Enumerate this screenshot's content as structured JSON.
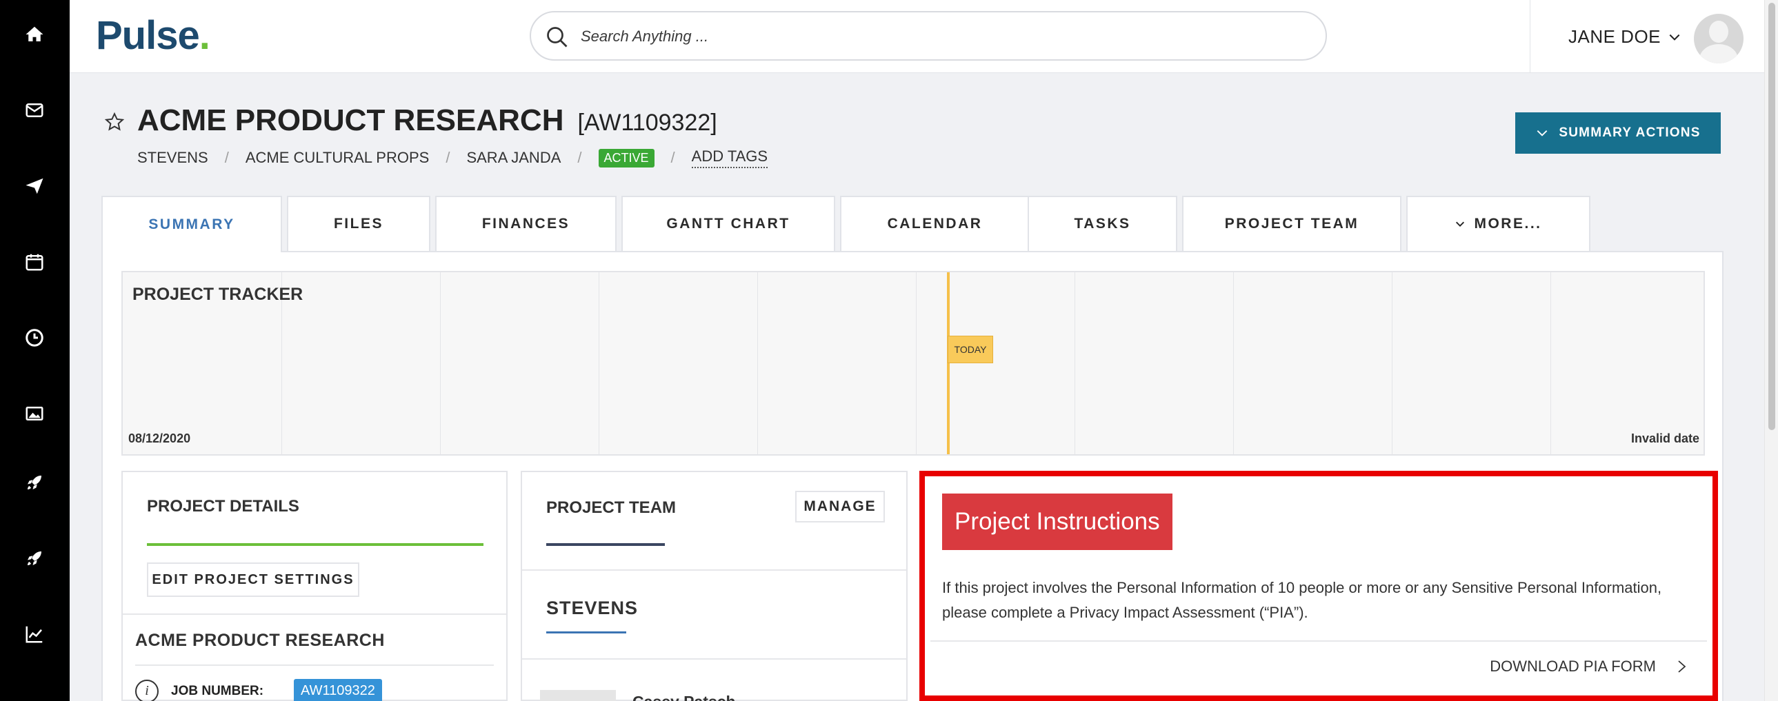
{
  "brand": {
    "logo_text": "Pulse",
    "logo_dot": "."
  },
  "sidebar": {
    "items": [
      {
        "icon": "home-icon"
      },
      {
        "icon": "mail-icon"
      },
      {
        "icon": "send-icon"
      },
      {
        "icon": "calendar-icon"
      },
      {
        "icon": "clock-icon"
      },
      {
        "icon": "image-icon"
      },
      {
        "icon": "rocket-icon"
      },
      {
        "icon": "rocket-icon"
      },
      {
        "icon": "chart-line-icon"
      }
    ]
  },
  "header": {
    "search_placeholder": "Search Anything ...",
    "user_name": "JANE DOE"
  },
  "project": {
    "title": "ACME PRODUCT RESEARCH",
    "code": "[AW1109322]",
    "breadcrumbs": [
      "STEVENS",
      "ACME CULTURAL PROPS",
      "SARA JANDA"
    ],
    "status": "ACTIVE",
    "add_tags": "ADD TAGS",
    "summary_actions": "SUMMARY ACTIONS"
  },
  "tabs": [
    {
      "label": "SUMMARY",
      "active": true
    },
    {
      "label": "FILES"
    },
    {
      "label": "FINANCES"
    },
    {
      "label": "GANTT CHART"
    },
    {
      "label": "CALENDAR"
    },
    {
      "label": "TASKS"
    },
    {
      "label": "PROJECT TEAM"
    },
    {
      "label": "MORE..."
    }
  ],
  "tracker": {
    "title": "PROJECT TRACKER",
    "start_date": "08/12/2020",
    "end_date": "Invalid date",
    "today_label": "TODAY"
  },
  "details": {
    "title": "PROJECT DETAILS",
    "edit_button": "EDIT PROJECT SETTINGS",
    "project_name": "ACME PRODUCT RESEARCH",
    "job_number_label": "JOB NUMBER:",
    "job_number": "AW1109322"
  },
  "team": {
    "title": "PROJECT TEAM",
    "manage_button": "MANAGE",
    "group": "STEVENS",
    "member_name": "Casey Patsch"
  },
  "instructions": {
    "title": "Project Instructions",
    "text": "If this project involves the Personal Information of 10 people or more or any Sensitive Personal Information, please complete a Privacy Impact Assessment (“PIA”).",
    "download_link": "DOWNLOAD PIA FORM"
  },
  "colors": {
    "rail": "#000000",
    "accent_teal": "#17708e",
    "active_tab": "#3b74b3",
    "status_green": "#3aa835",
    "today_yellow": "#f5c04a",
    "instruction_red": "#d93a3f",
    "highlight_border": "#e80000",
    "job_badge": "#3593d8"
  }
}
